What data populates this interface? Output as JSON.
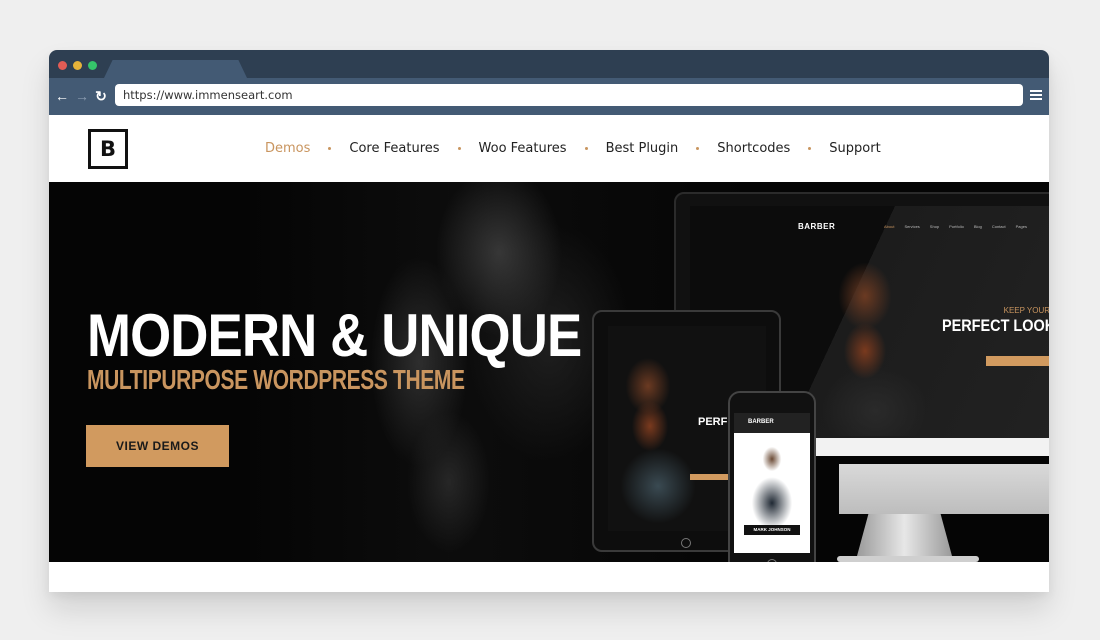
{
  "browser": {
    "url": "https://www.immenseart.com",
    "back_icon": "arrow-left-icon",
    "forward_icon": "arrow-right-icon",
    "reload_icon": "reload-icon",
    "menu_icon": "hamburger-icon",
    "colors": {
      "chrome_dark": "#2e3f52",
      "chrome_light": "#435a74"
    }
  },
  "site": {
    "logo": "B",
    "nav": [
      {
        "label": "Demos",
        "active": true
      },
      {
        "label": "Core Features",
        "active": false
      },
      {
        "label": "Woo Features",
        "active": false
      },
      {
        "label": "Best Plugin",
        "active": false
      },
      {
        "label": "Shortcodes",
        "active": false
      },
      {
        "label": "Support",
        "active": false
      }
    ],
    "accent_color": "#c9955f"
  },
  "hero": {
    "title": "MODERN & UNIQUE",
    "subtitle": "MULTIPURPOSE WORDPRESS THEME",
    "cta_label": "VIEW DEMOS",
    "cta_color": "#d19a5f"
  },
  "devices": {
    "monitor": {
      "logo": "BARBER",
      "nav": [
        "About",
        "Services",
        "Shop",
        "Portfolio",
        "Blog",
        "Contact",
        "Pages"
      ],
      "kicker": "KEEP YOUR",
      "headline": "PERFECT LOOK"
    },
    "tablet": {
      "headline": "PERFECT L"
    },
    "phone": {
      "logo": "BARBER",
      "name": "MARK JOHNSON"
    }
  }
}
